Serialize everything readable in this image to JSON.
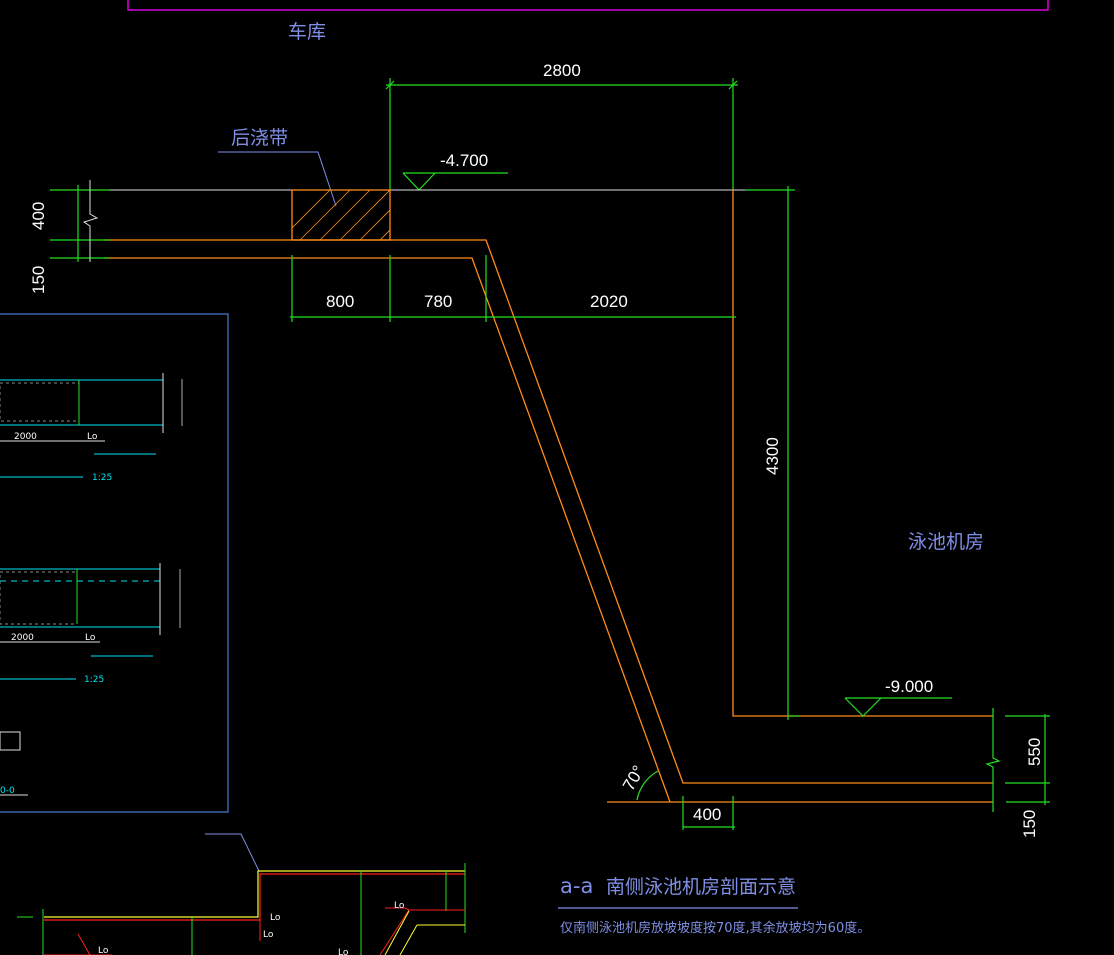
{
  "drawing": {
    "top_area_label": "车库",
    "post_pour_strip_label": "后浇带",
    "room_label": "泳池机房",
    "elevation_top": "-4.700",
    "elevation_bottom": "-9.000",
    "angle_label": "70°",
    "dimensions": {
      "top_width": "2800",
      "slab_thickness": "400",
      "slab_step": "150",
      "seg_1": "800",
      "seg_2": "780",
      "seg_3": "2020",
      "wall_height": "4300",
      "floor_thickness": "550",
      "floor_step": "150",
      "toe_width": "400"
    },
    "title": {
      "section_id": "a-a",
      "name": "南侧泳池机房剖面示意",
      "note": "仅南侧泳池机房放坡坡度按70度,其余放坡均为60度。"
    }
  },
  "left_panel": {
    "detail1": {
      "dim": "2000",
      "lap": "Lo",
      "scale": "1:25"
    },
    "detail2": {
      "dim": "2000",
      "lap": "Lo",
      "scale": "1:25"
    },
    "section_tag": "0-0"
  },
  "bottom_detail": {
    "lap_labels": [
      "Lo",
      "Lo",
      "Lo",
      "Lo",
      "Lo"
    ]
  },
  "colors": {
    "background": "#000000",
    "structure": "#ff8c1a",
    "dimension": "#22e022",
    "text_cn": "#7f8fe6",
    "frame": "#ff00ff"
  }
}
